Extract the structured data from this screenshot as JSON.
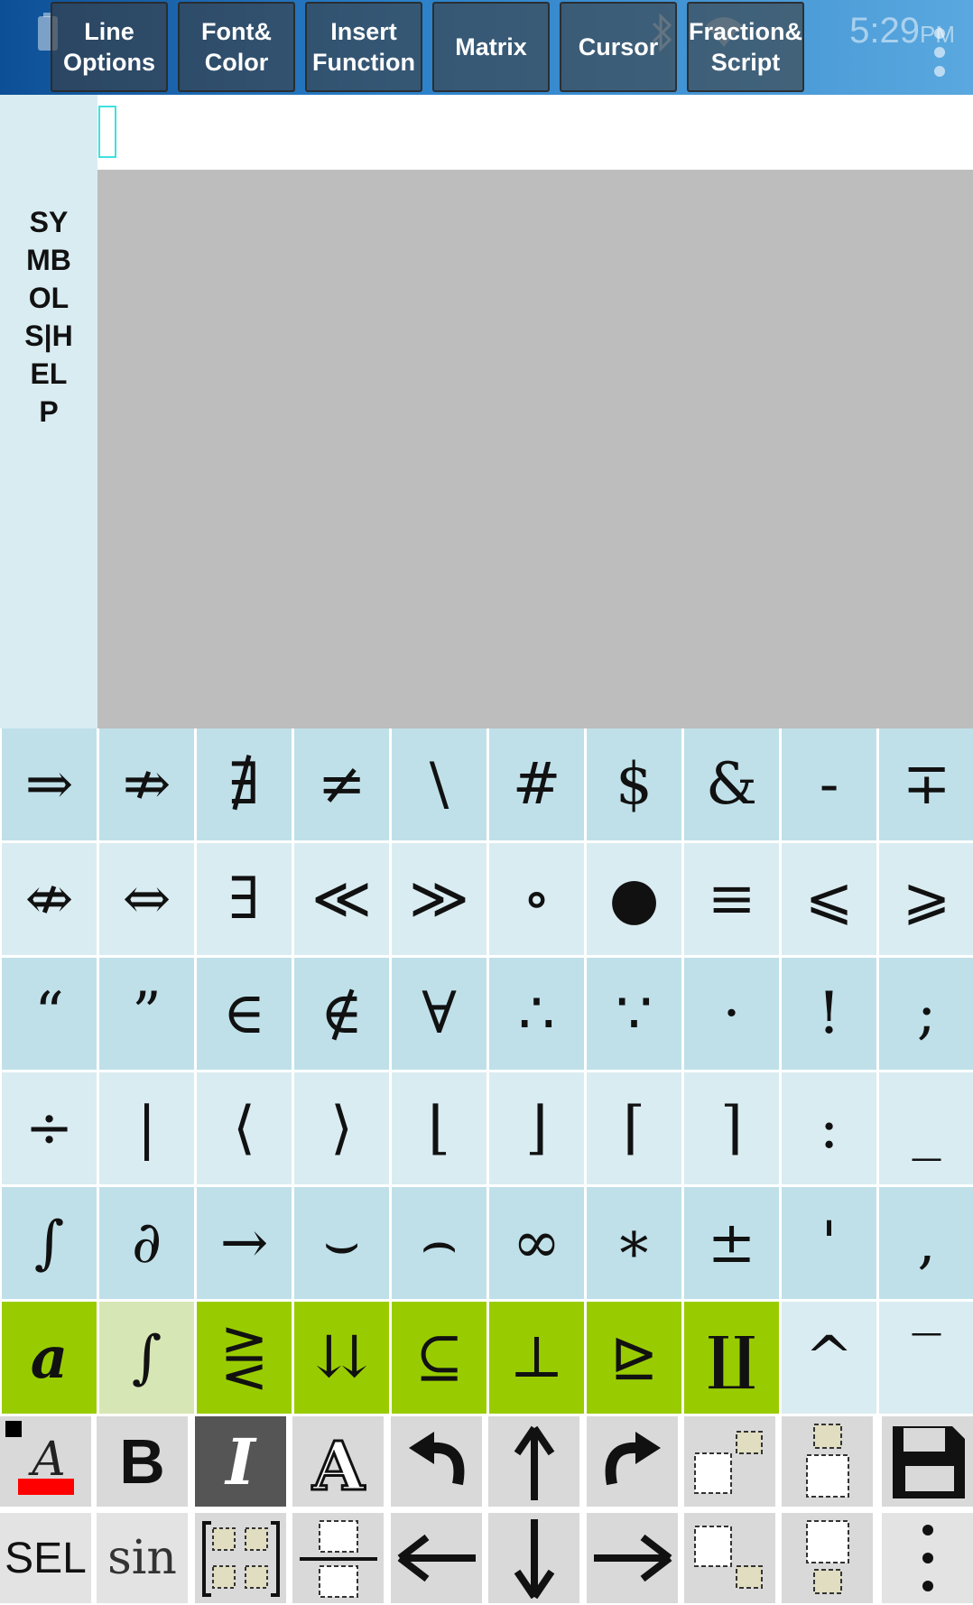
{
  "toolbar": {
    "buttons": [
      "Line\nOptions",
      "Font&\nColor",
      "Insert\nFunction",
      "Matrix",
      "Cursor",
      "Fraction&\nScript"
    ],
    "clock": "5:29",
    "clock_ampm": "PM"
  },
  "side_panel": {
    "label": "SYMBOLS|HELP"
  },
  "symbols": {
    "row1": [
      "⇒",
      "⇏",
      "∄",
      "≠",
      "\\",
      "#",
      "$",
      "&",
      "-",
      "∓"
    ],
    "row2": [
      "⇎",
      "⇔",
      "∃",
      "≪",
      "≫",
      "∘",
      "●",
      "≡",
      "⩽",
      "⩾"
    ],
    "row3": [
      "“",
      "”",
      "∈",
      "∉",
      "∀",
      "∴",
      "∵",
      "·",
      "!",
      ";"
    ],
    "row4": [
      "÷",
      "|",
      "⟨",
      "⟩",
      "⌊",
      "⌋",
      "⌈",
      "⌉",
      ":",
      "_"
    ],
    "row5": [
      "∫",
      "∂",
      "→",
      "⌣",
      "⌢",
      "∞",
      "∗",
      "±",
      "'",
      ","
    ],
    "row6": [
      "a",
      "∫",
      "⋛",
      "⇊",
      "⊆",
      "⊥",
      "⊵",
      "∐",
      "^",
      "‾"
    ]
  },
  "tools": {
    "row1": [
      "text-color",
      "B",
      "I",
      "font",
      "undo",
      "up",
      "redo",
      "superscript",
      "over",
      "save"
    ],
    "row2": [
      "SEL",
      "sin",
      "matrix",
      "fraction",
      "left",
      "down",
      "right",
      "subscript",
      "under",
      "more"
    ]
  },
  "colors": {
    "cell_light": "#d9ecf1",
    "cell_mid": "#bfe0e9",
    "category_green": "#99cc00",
    "category_pale": "#d7e6b5",
    "accent_red": "#ff0000"
  }
}
